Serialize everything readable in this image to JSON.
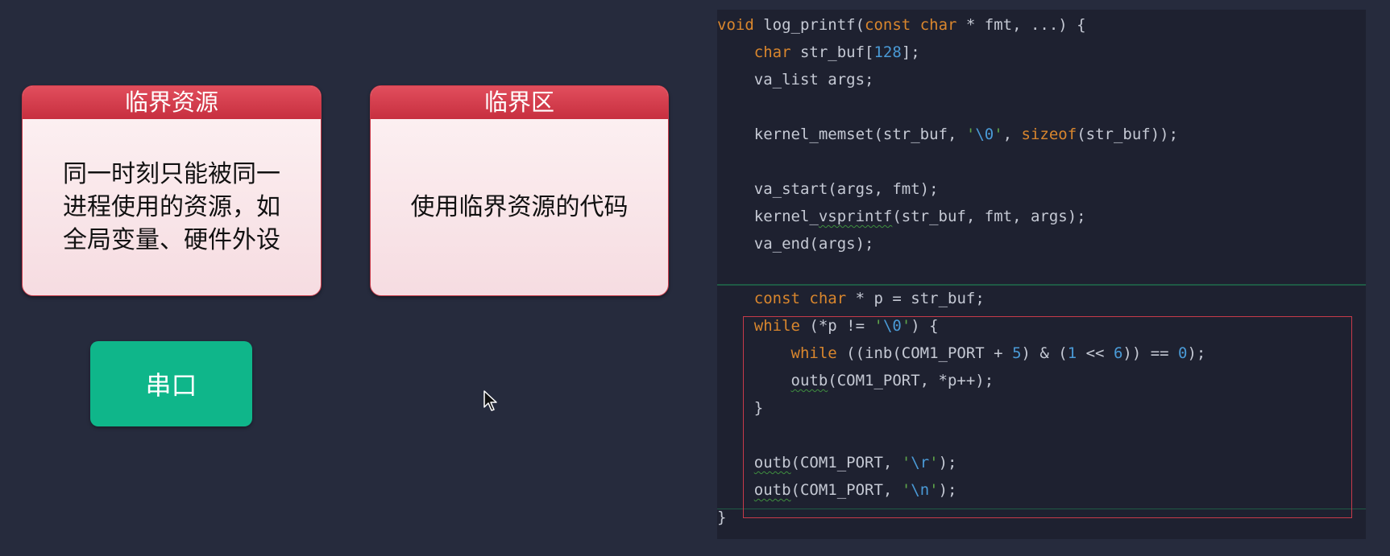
{
  "cards": [
    {
      "title": "临界资源",
      "body_lines": [
        "同一时刻只能被同一",
        "进程使用的资源，如",
        "全局变量、硬件外设"
      ]
    },
    {
      "title": "临界区",
      "body_lines": [
        "使用临界资源的代码"
      ]
    }
  ],
  "serial_label": "串口",
  "code": {
    "lines": [
      "void log_printf(const char * fmt, ...) {",
      "    char str_buf[128];",
      "    va_list args;",
      "",
      "    kernel_memset(str_buf, '\\0', sizeof(str_buf));",
      "",
      "    va_start(args, fmt);",
      "    kernel_vsprintf(str_buf, fmt, args);",
      "    va_end(args);",
      "",
      "    const char * p = str_buf;",
      "    while (*p != '\\0') {",
      "        while ((inb(COM1_PORT + 5) & (1 << 6)) == 0);",
      "        outb(COM1_PORT, *p++);",
      "    }",
      "",
      "    outb(COM1_PORT, '\\r');",
      "    outb(COM1_PORT, '\\n');",
      "}"
    ]
  },
  "colors": {
    "background": "#262b3d",
    "card_header": "#d43c4c",
    "serial_button": "#0fb68a",
    "code_background": "#1e2130",
    "keyword": "#d9862d",
    "number": "#4a9ad6",
    "highlight_border": "#c73a4a"
  }
}
